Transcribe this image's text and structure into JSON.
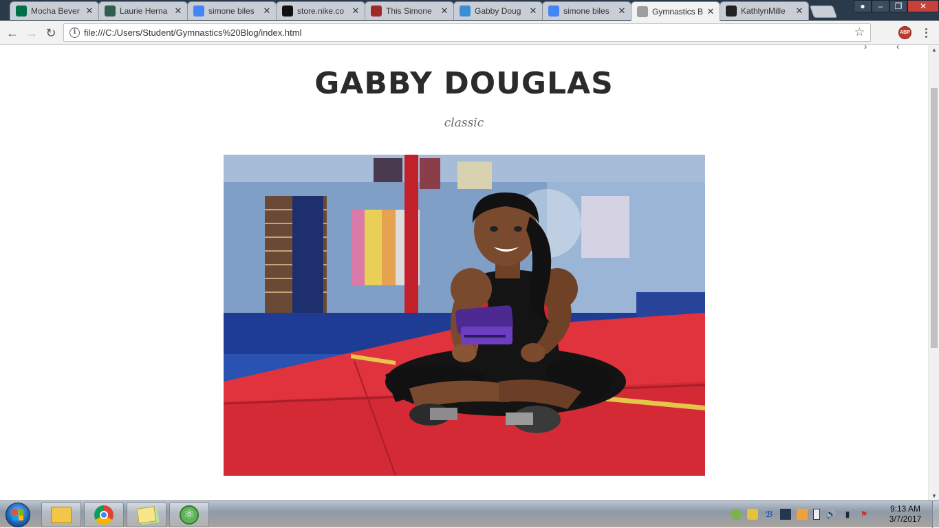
{
  "browser": {
    "tabs": [
      {
        "title": "Mocha Bever",
        "favicon": "starbucks-icon",
        "favicon_color": "#00704a"
      },
      {
        "title": "Laurie Herna",
        "favicon": "h-icon",
        "favicon_color": "#2e5e4e"
      },
      {
        "title": "simone biles",
        "favicon": "google-icon",
        "favicon_color": "#4285f4"
      },
      {
        "title": "store.nike.co",
        "favicon": "nike-icon",
        "favicon_color": "#111111"
      },
      {
        "title": "This Simone",
        "favicon": "tumblr-icon",
        "favicon_color": "#a02a2a"
      },
      {
        "title": "Gabby Doug",
        "favicon": "jj-icon",
        "favicon_color": "#3a8fd4"
      },
      {
        "title": "simone biles",
        "favicon": "google-icon",
        "favicon_color": "#4285f4"
      },
      {
        "title": "Gymnastics B",
        "favicon": "page-icon",
        "favicon_color": "#9e9e9e",
        "active": true
      },
      {
        "title": "KathlynMille",
        "favicon": "github-icon",
        "favicon_color": "#222222"
      }
    ],
    "address_bar": {
      "url": "file:///C:/Users/Student/Gymnastics%20Blog/index.html"
    },
    "extension_label": "ABP"
  },
  "page": {
    "title": "GABBY DOUGLAS",
    "subtitle": "classic",
    "image_alt": "gymnast-sitting-on-mat-photo"
  },
  "taskbar": {
    "pinned": [
      "explorer-icon",
      "chrome-icon",
      "sticky-notes-icon",
      "atom-icon"
    ],
    "clock": {
      "time": "9:13 AM",
      "date": "3/7/2017"
    }
  }
}
